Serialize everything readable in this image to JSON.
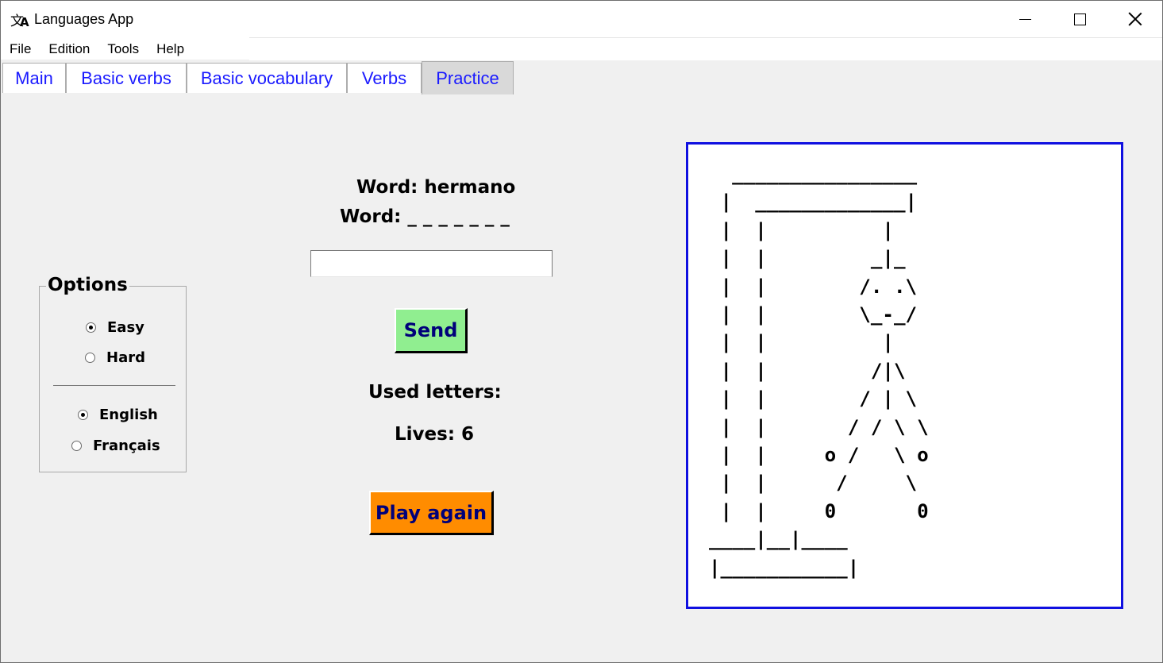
{
  "window": {
    "title": "Languages App",
    "icon": "translate-icon",
    "controls": [
      "minimize-icon",
      "maximize-icon",
      "close-icon"
    ]
  },
  "menu": {
    "items": [
      "File",
      "Edition",
      "Tools",
      "Help"
    ]
  },
  "tabs": {
    "items": [
      "Main",
      "Basic verbs",
      "Basic vocabulary",
      "Verbs",
      "Practice"
    ],
    "active": "Practice"
  },
  "options": {
    "title": "Options",
    "difficulty": [
      {
        "label": "Easy",
        "checked": true
      },
      {
        "label": "Hard",
        "checked": false
      }
    ],
    "language": [
      {
        "label": "English",
        "checked": true
      },
      {
        "label": "Français",
        "checked": false
      }
    ]
  },
  "game": {
    "word_label": "Word: hermano",
    "masked_label": "Word: _ _ _ _ _ _ _",
    "input_value": "",
    "send_label": "Send",
    "used_letters_label": "Used letters:",
    "lives_label": "Lives: 6",
    "play_again_label": "Play again"
  },
  "hangman": {
    "ascii": "  ________________\n |  _____________|\n |  |          |\n |  |         _|_\n |  |        /. .\\\n |  |        \\_-_/\n |  |          |\n |  |         /|\\\n |  |        / | \\\n |  |       / / \\ \\\n |  |     o /   \\ o\n |  |      /     \\\n |  |     0       0\n____|__|____\n|___________|"
  },
  "colors": {
    "tab_text": "#1a1aff",
    "send_bg": "#90ee90",
    "play_bg": "#ff8c00",
    "button_text": "#00007a",
    "hangman_border": "#1010e0"
  }
}
